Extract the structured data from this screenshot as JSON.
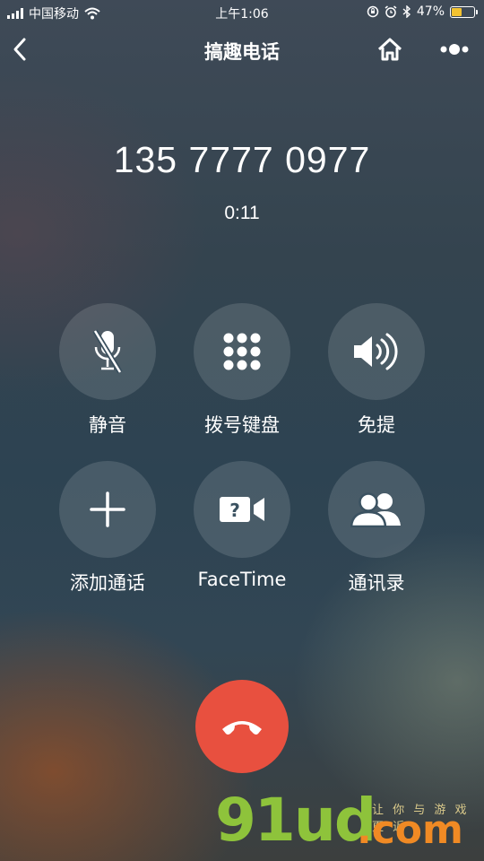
{
  "status_bar": {
    "carrier": "中国移动",
    "time": "上午1:06",
    "battery_percent": "47%",
    "battery_level": 0.47,
    "icons": [
      "signal-icon",
      "wifi-icon",
      "orientation-lock-icon",
      "alarm-icon",
      "bluetooth-icon",
      "battery-icon"
    ],
    "battery_color": "#f2c230"
  },
  "nav": {
    "title": "搞趣电话",
    "icons": [
      "back-icon",
      "home-icon",
      "more-icon"
    ]
  },
  "call": {
    "number": "135 7777 0977",
    "duration": "0:11"
  },
  "buttons": [
    {
      "label": "静音",
      "icon": "mute-microphone-icon"
    },
    {
      "label": "拨号键盘",
      "icon": "keypad-icon"
    },
    {
      "label": "免提",
      "icon": "speaker-icon"
    },
    {
      "label": "添加通话",
      "icon": "plus-icon"
    },
    {
      "label": "FaceTime",
      "icon": "facetime-video-icon"
    },
    {
      "label": "通讯录",
      "icon": "contacts-icon"
    }
  ],
  "end_call": {
    "icon": "end-call-phone-icon",
    "color": "#e8503f"
  },
  "watermark": {
    "main": "91ud",
    "suffix": ".com",
    "sub": "让 你 与 游 戏 更 近"
  }
}
